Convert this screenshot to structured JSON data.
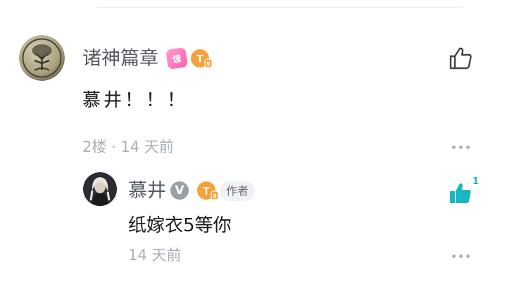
{
  "comment": {
    "user": "诸神篇章",
    "level_badge": "T",
    "level_sub": "9",
    "decor_badge": "饿",
    "text": "慕井！！！",
    "meta": "2楼 · 14 天前"
  },
  "reply": {
    "user": "慕井",
    "verified": "V",
    "level_badge": "T",
    "level_sub": "8",
    "author_tag": "作者",
    "text": "纸嫁衣5等你",
    "meta": "14 天前",
    "like_count": "1",
    "liked": true
  },
  "colors": {
    "accent": "#19b6c4",
    "meta_gray": "#aab0b7",
    "level_orange": "#f6a23a"
  }
}
